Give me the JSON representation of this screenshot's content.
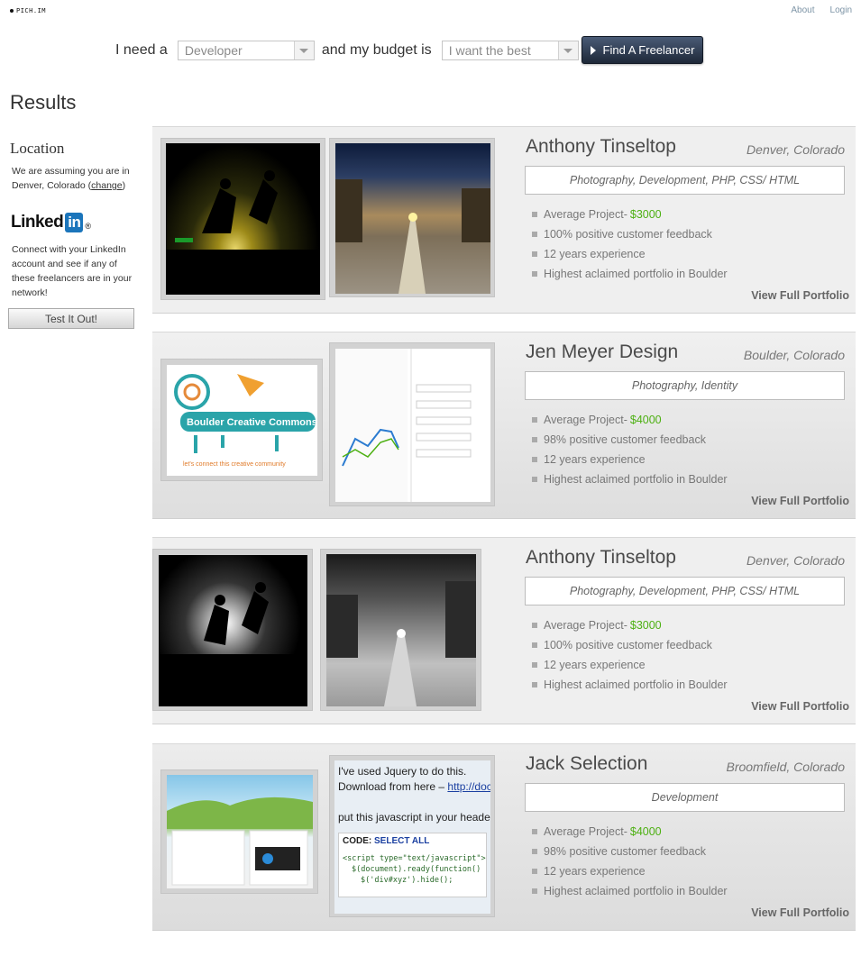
{
  "brand": {
    "logo_text": "PICH.IM"
  },
  "nav": {
    "about": "About",
    "login": "Login"
  },
  "search": {
    "prefix": "I need a",
    "role_value": "Developer",
    "middle": "and my budget is",
    "budget_value": "I want the best",
    "button_label": "Find A Freelancer"
  },
  "results_title": "Results",
  "sidebar": {
    "location_title": "Location",
    "location_text": "We are assuming you are in Denver, Colorado (",
    "location_link": "change",
    "location_close": ")",
    "linkedin_word": "Linked",
    "linkedin_in": "in",
    "linkedin_reg": "®",
    "linkedin_text": "Connect with your LinkedIn account and see if any of these freelancers are in your network!",
    "test_button": "Test It Out!"
  },
  "freelancers": [
    {
      "name": "Anthony Tinseltop",
      "location": "Denver, Colorado",
      "skills": "Photography, Development, PHP, CSS/ HTML",
      "avg_label": "Average Project-",
      "avg_price": "$3000",
      "feedback": "100% positive customer feedback",
      "experience": "12 years experience",
      "portfolio_note": "Highest aclaimed portfolio in Boulder",
      "view_link": "View Full Portfolio"
    },
    {
      "name": "Jen Meyer Design",
      "location": "Boulder, Colorado",
      "skills": "Photography, Identity",
      "avg_label": "Average Project-",
      "avg_price": "$4000",
      "feedback": "98% positive customer feedback",
      "experience": "12 years experience",
      "portfolio_note": "Highest aclaimed portfolio in Boulder",
      "view_link": "View Full Portfolio"
    },
    {
      "name": "Anthony Tinseltop",
      "location": "Denver, Colorado",
      "skills": "Photography, Development, PHP, CSS/ HTML",
      "avg_label": "Average Project-",
      "avg_price": "$3000",
      "feedback": "100% positive customer feedback",
      "experience": "12 years experience",
      "portfolio_note": "Highest aclaimed portfolio in Boulder",
      "view_link": "View Full Portfolio"
    },
    {
      "name": "Jack Selection",
      "location": "Broomfield, Colorado",
      "skills": "Development",
      "avg_label": "Average Project-",
      "avg_price": "$4000",
      "feedback": "98% positive customer feedback",
      "experience": "12 years experience",
      "portfolio_note": "Highest aclaimed portfolio in Boulder",
      "view_link": "View Full Portfolio"
    }
  ],
  "thumbnails": {
    "bcc_title": "Boulder Creative Commons",
    "bcc_tagline": "let's connect this creative community",
    "code_line1": "I've used Jquery to do this.",
    "code_line2": "Download from here –",
    "code_link": "http://docs.jqu",
    "code_line3": "put this javascript in your header:",
    "code_label": "CODE:",
    "code_select": "SELECT ALL",
    "code_snippet_1": "<script type=\"text/javascript\">",
    "code_snippet_2": "$(document).ready(function() {",
    "code_snippet_3": "$('div#xyz').hide();"
  },
  "colors": {
    "price_green": "#4db012",
    "button_navy": "#1e2838",
    "linkedin_blue": "#1b75bb"
  }
}
